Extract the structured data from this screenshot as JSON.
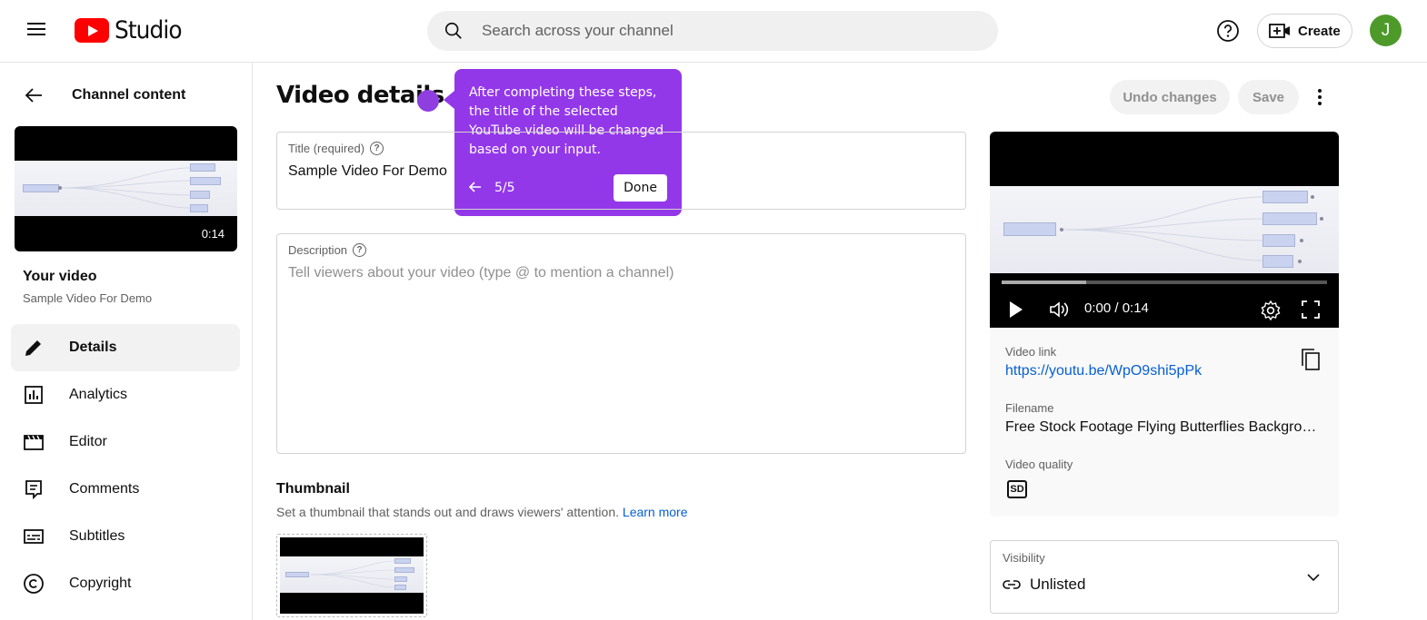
{
  "header": {
    "logo_text": "Studio",
    "search_placeholder": "Search across your channel",
    "create_label": "Create",
    "avatar_initial": "J"
  },
  "sidebar": {
    "back_label": "Channel content",
    "thumb_duration": "0:14",
    "your_video_label": "Your video",
    "video_title": "Sample Video For Demo",
    "items": [
      {
        "label": "Details",
        "icon": "pencil-icon",
        "active": true
      },
      {
        "label": "Analytics",
        "icon": "analytics-icon"
      },
      {
        "label": "Editor",
        "icon": "editor-icon"
      },
      {
        "label": "Comments",
        "icon": "comments-icon"
      },
      {
        "label": "Subtitles",
        "icon": "subtitles-icon"
      },
      {
        "label": "Copyright",
        "icon": "copyright-icon"
      }
    ]
  },
  "main": {
    "page_title": "Video details",
    "undo_label": "Undo changes",
    "save_label": "Save",
    "title_field": {
      "label": "Title (required)",
      "value": "Sample Video For Demo"
    },
    "description_field": {
      "label": "Description",
      "placeholder": "Tell viewers about your video (type @ to mention a channel)"
    },
    "thumbnail": {
      "heading": "Thumbnail",
      "subtitle": "Set a thumbnail that stands out and draws viewers' attention.",
      "learn_more": "Learn more"
    }
  },
  "tour": {
    "text": "After completing these steps, the title of the selected YouTube video will be changed based on your input.",
    "step": "5/5",
    "done_label": "Done",
    "color": "#9338e9"
  },
  "video_panel": {
    "time": "0:00 / 0:14",
    "progress_fraction": 0.26,
    "video_link_label": "Video link",
    "video_link": "https://youtu.be/WpO9shi5pPk",
    "filename_label": "Filename",
    "filename": "Free Stock Footage Flying Butterflies Backgro…",
    "quality_label": "Video quality",
    "quality_badge": "SD",
    "mindmap": {
      "root": "Invoice 2386/2023",
      "branches": [
        "Invoice Details",
        "Billing Information",
        "Line Items",
        "Summary"
      ]
    }
  },
  "visibility": {
    "label": "Visibility",
    "value": "Unlisted"
  }
}
